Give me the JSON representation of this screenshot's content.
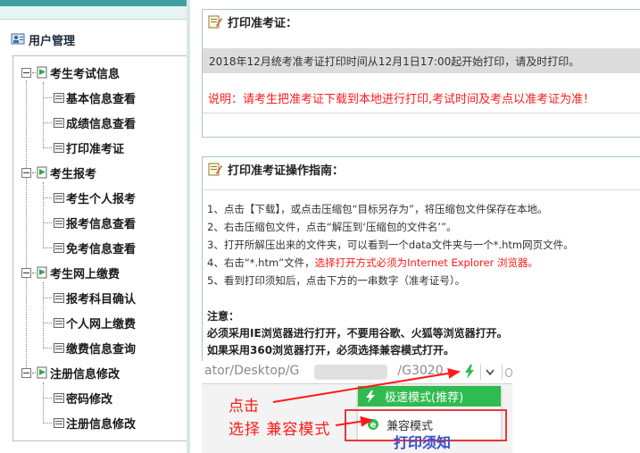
{
  "sidebar": {
    "title": "用户管理",
    "groups": [
      {
        "label": "考生考试信息",
        "items": [
          "基本信息查看",
          "成绩信息查看",
          "打印准考证"
        ]
      },
      {
        "label": "考生报考",
        "items": [
          "考生个人报考",
          "报考信息查看",
          "免考信息查看"
        ]
      },
      {
        "label": "考生网上缴费",
        "items": [
          "报考科目确认",
          "个人网上缴费",
          "缴费信息查询"
        ]
      },
      {
        "label": "注册信息修改",
        "items": [
          "密码修改",
          "注册信息修改"
        ]
      }
    ]
  },
  "print_panel": {
    "title": "打印准考证：",
    "notice": "2018年12月统考准考证打印时间从12月1日17:00起开始打印，请及时打印。",
    "warning": "说明：请考生把准考证下载到本地进行打印,考试时间及考点以准考证为准！"
  },
  "guide_panel": {
    "title": "打印准考证操作指南：",
    "steps": [
      {
        "text": "1、点击【下载】，或点击压缩包“目标另存为”，将压缩包文件保存在本地。",
        "red": ""
      },
      {
        "text": "2、右击压缩包文件，点击“解压到‘压缩包的文件名’”。",
        "red": ""
      },
      {
        "text": "3、打开所解压出来的文件夹，可以看到一个data文件夹与一个*.htm网页文件。",
        "red": ""
      },
      {
        "text": "4、右击“*.htm”文件，",
        "red": "选择打开方式必须为Internet Explorer 浏览器。"
      },
      {
        "text": "5、看到打印须知后，点击下方的一串数字（准考证号）。",
        "red": ""
      }
    ],
    "note_title": "注意：",
    "note_lines": [
      "必须采用IE浏览器进行打开，不要用谷歌、火狐等浏览器打开。",
      "如果采用360浏览器打开，必须选择兼容模式打开。"
    ]
  },
  "screenshot": {
    "url_left": "ator/Desktop/G",
    "url_right": "/G3020",
    "menu_fast": "极速模式(推荐)",
    "menu_compat": "兼容模式",
    "annotation_click": "点击",
    "annotation_select": "选择 兼容模式",
    "cut_text": "打印须知",
    "accent_green": "#2fbb4f",
    "accent_red": "#ff1a1a"
  }
}
